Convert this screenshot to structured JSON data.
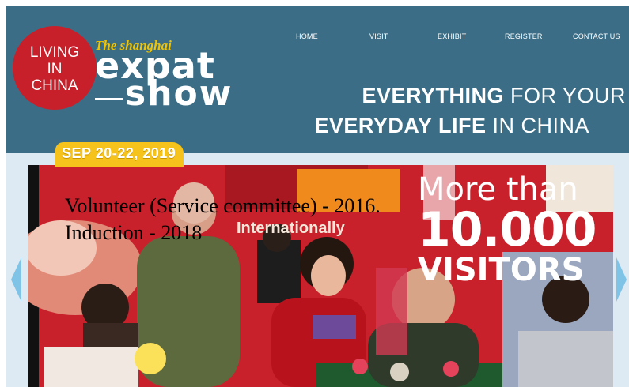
{
  "logo": {
    "circle_lines": [
      "LIVING",
      "IN",
      "CHINA"
    ],
    "tag": "The shanghai",
    "word1": "expat",
    "word2": "show",
    "circle_color": "#c8202a",
    "tag_color": "#f2c400"
  },
  "nav": {
    "items": [
      "HOME",
      "VISIT",
      "EXHIBIT",
      "REGISTER",
      "CONTACT US"
    ]
  },
  "tagline": {
    "line1_bold": "EVERYTHING",
    "line1_rest": "FOR YOUR",
    "line2_bold": "EVERYDAY LIFE",
    "line2_rest": "IN CHINA"
  },
  "date_badge": "SEP 20-22, 2019",
  "banner": {
    "line1": "More than",
    "line2": "10.000",
    "line3": "VISITORS"
  },
  "overlay": {
    "line1": "Volunteer (Service committee) - 2016.",
    "line2": "Induction - 2018"
  },
  "booth_sign": "Internationally",
  "colors": {
    "header_bg": "#3b6e86",
    "badge_bg": "#f6c21c",
    "arrow": "#7fc4e6",
    "booth_red": "#c8212b"
  }
}
